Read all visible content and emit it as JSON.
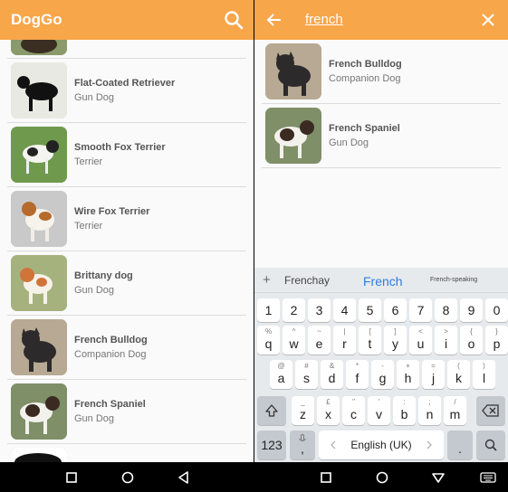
{
  "left_screen": {
    "app_title": "DogGo",
    "breeds": [
      {
        "name": "Flat-Coated Retriever",
        "group": "Gun Dog"
      },
      {
        "name": "Smooth Fox Terrier",
        "group": "Terrier"
      },
      {
        "name": "Wire Fox Terrier",
        "group": "Terrier"
      },
      {
        "name": "Brittany dog",
        "group": "Gun Dog"
      },
      {
        "name": "French Bulldog",
        "group": "Companion Dog"
      },
      {
        "name": "French Spaniel",
        "group": "Gun Dog"
      }
    ]
  },
  "right_screen": {
    "search_query": "french",
    "results": [
      {
        "name": "French Bulldog",
        "group": "Companion Dog"
      },
      {
        "name": "French Spaniel",
        "group": "Gun Dog"
      }
    ],
    "keyboard": {
      "suggestions": [
        "Frenchay",
        "French",
        "French-speaking"
      ],
      "space_label": "English (UK)",
      "symbols_label": "123",
      "number_row": [
        "1",
        "2",
        "3",
        "4",
        "5",
        "6",
        "7",
        "8",
        "9",
        "0"
      ],
      "row1_main": [
        "q",
        "w",
        "e",
        "r",
        "t",
        "y",
        "u",
        "i",
        "o",
        "p"
      ],
      "row1_sym": [
        "%",
        "^",
        "~",
        "|",
        "[",
        "]",
        "<",
        ">",
        "{",
        "}"
      ],
      "row2_main": [
        "a",
        "s",
        "d",
        "f",
        "g",
        "h",
        "j",
        "k",
        "l"
      ],
      "row2_sym": [
        "@",
        "#",
        "&",
        "*",
        "-",
        "+",
        "=",
        "(",
        ")"
      ],
      "row3_main": [
        "z",
        "x",
        "c",
        "v",
        "b",
        "n",
        "m"
      ],
      "row3_sym": [
        "_",
        "£",
        "\"",
        "'",
        ":",
        ";",
        "/"
      ],
      "comma": ",",
      "period": "."
    }
  },
  "colors": {
    "app_bar": "#f7a64a",
    "accent_blue": "#2b7de1"
  }
}
